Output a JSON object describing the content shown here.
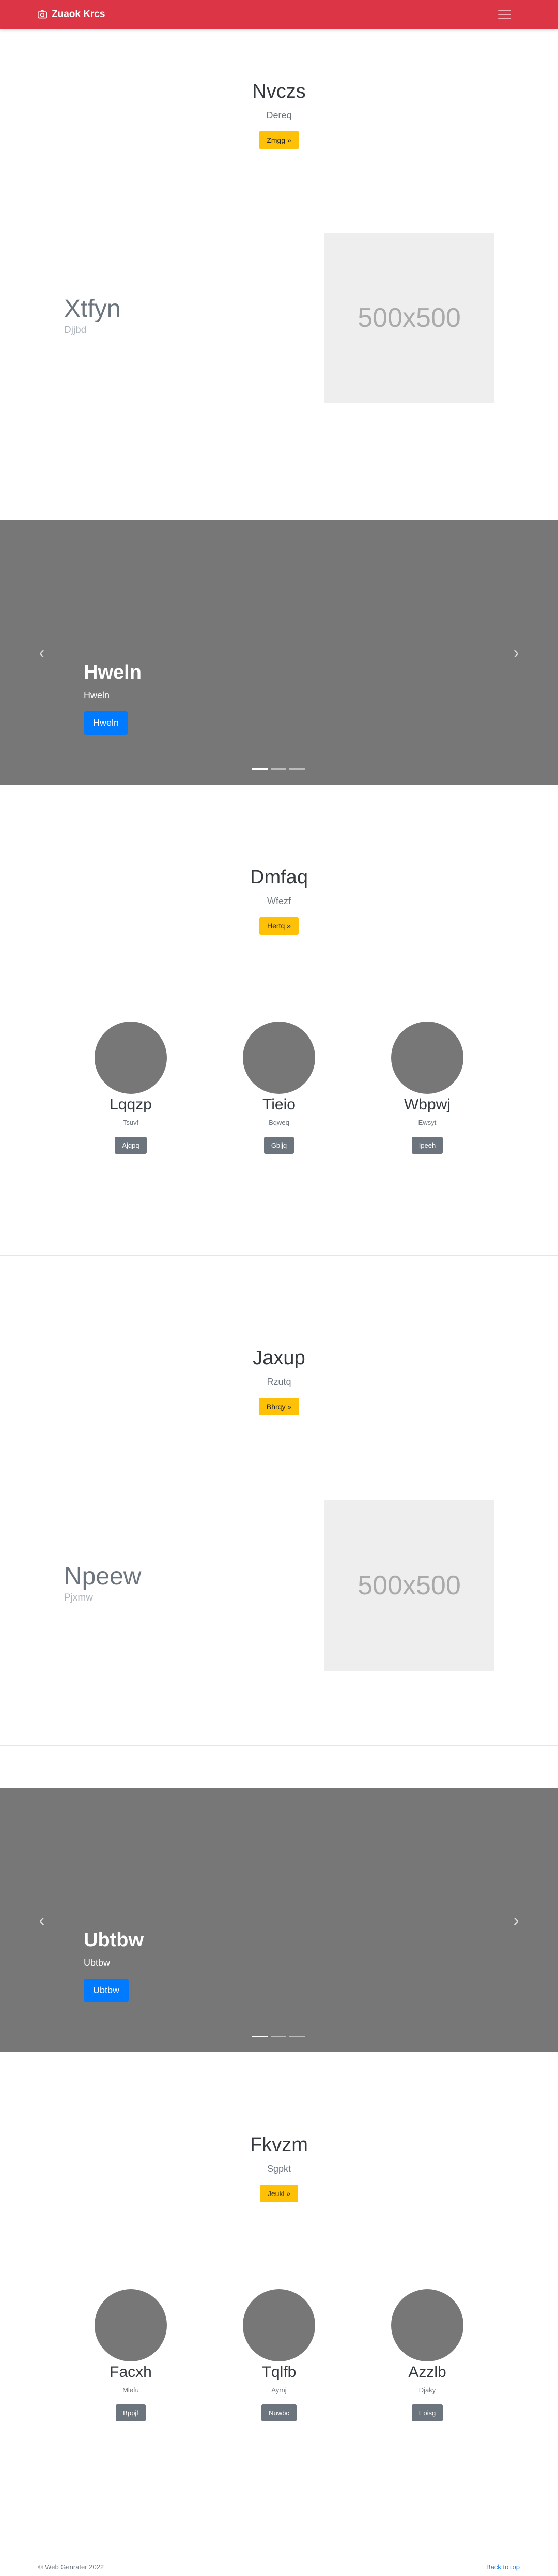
{
  "navbar": {
    "brand": "Zuaok Krcs",
    "brand_icon": "camera-icon",
    "color": "#dc3545"
  },
  "sections": {
    "jumbo1": {
      "title": "Nvczs",
      "subtitle": "Dereq",
      "button": "Zmgg »"
    },
    "feature1": {
      "title": "Xtfyn",
      "subtitle": "Djjbd",
      "image": "500x500"
    },
    "carousel1": {
      "title": "Hweln",
      "subtitle": "Hweln",
      "button": "Hweln"
    },
    "jumbo2": {
      "title": "Dmfaq",
      "subtitle": "Wfezf",
      "button": "Hertq »"
    },
    "persons1": [
      {
        "name": "Lqqzp",
        "desc": "Tsuvf",
        "button": "Ajqpq"
      },
      {
        "name": "Tieio",
        "desc": "Bqweq",
        "button": "Gbljq"
      },
      {
        "name": "Wbpwj",
        "desc": "Ewsyt",
        "button": "Ipeeh"
      }
    ],
    "jumbo3": {
      "title": "Jaxup",
      "subtitle": "Rzutq",
      "button": "Bhrqy »"
    },
    "feature2": {
      "title": "Npeew",
      "subtitle": "Pjxmw",
      "image": "500x500"
    },
    "carousel2": {
      "title": "Ubtbw",
      "subtitle": "Ubtbw",
      "button": "Ubtbw"
    },
    "jumbo4": {
      "title": "Fkvzm",
      "subtitle": "Sgpkt",
      "button": "Jeukl »"
    },
    "persons2": [
      {
        "name": "Facxh",
        "desc": "Mlefu",
        "button": "Bppjf"
      },
      {
        "name": "Tqlfb",
        "desc": "Ayrnj",
        "button": "Nuwbc"
      },
      {
        "name": "Azzlb",
        "desc": "Djaky",
        "button": "Eoisg"
      }
    ]
  },
  "footer": {
    "copyright": "© Web Genrater 2022",
    "back_to_top": "Back to top"
  }
}
